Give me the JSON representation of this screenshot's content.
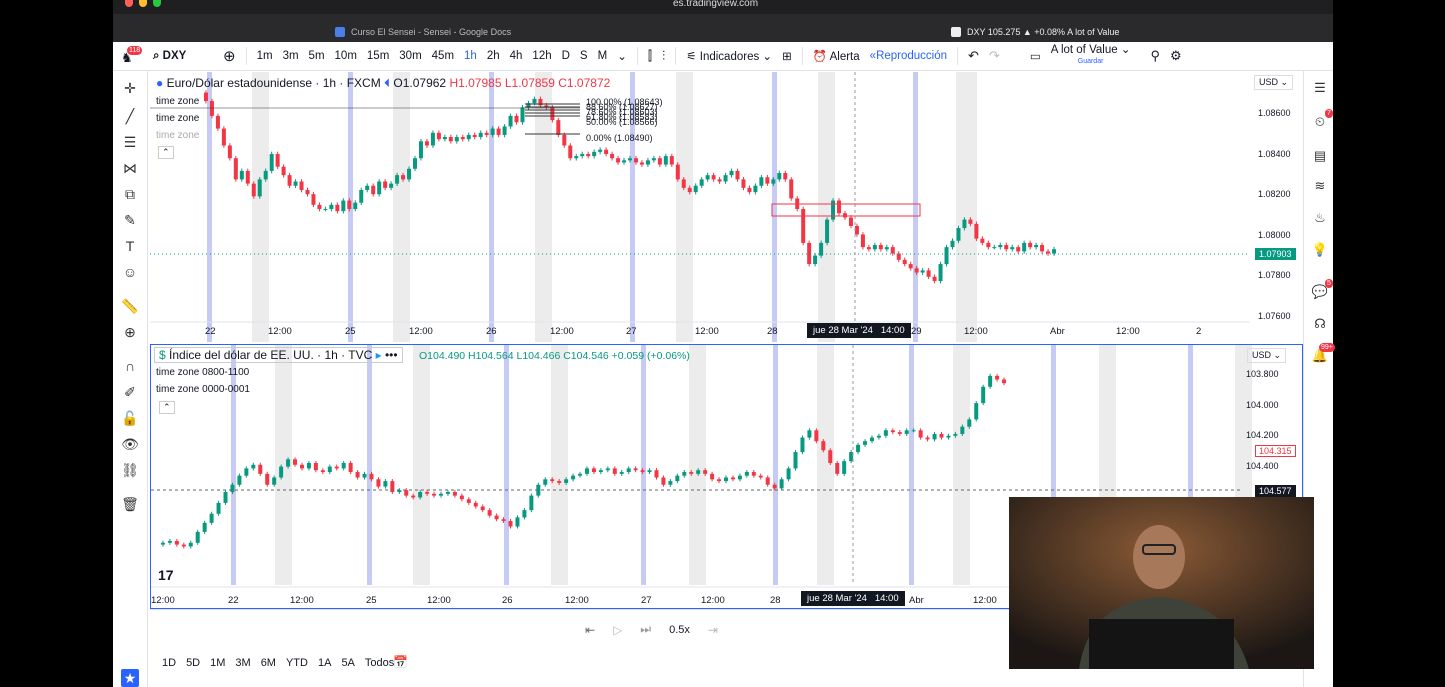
{
  "browser": {
    "url": "es.tradingview.com",
    "tab1": "Curso El Sensei - Sensei - Google Docs",
    "tab2": "DXY 105.275 ▲ +0.08% A lot of Value"
  },
  "toolbar": {
    "notif": "118",
    "symbol": "DXY",
    "intervals": [
      "1m",
      "3m",
      "5m",
      "10m",
      "15m",
      "30m",
      "45m",
      "1h",
      "2h",
      "4h",
      "12h",
      "D",
      "S",
      "M"
    ],
    "active_interval": "1h",
    "indicators": "Indicadores",
    "alert": "Alerta",
    "replay": "Reproducción",
    "layout_name": "A lot of Value",
    "layout_sub": "Guardar"
  },
  "pane1": {
    "title": "Euro/Dólar estadounidense · 1h · FXCM",
    "ohlc": {
      "o": "O1.07962",
      "h": "H1.07985",
      "l": "L1.07859",
      "c": "C1.07872"
    },
    "currency": "USD",
    "prices": [
      "1.08600",
      "1.08400",
      "1.08200",
      "1.08000",
      "1.07800",
      "1.07600"
    ],
    "last_price": "1.07903",
    "timezones": [
      "time zone",
      "time zone",
      "time zone"
    ],
    "fib": [
      "100.00% (1.08643)",
      "88.60% (1.08627)",
      "78.60% (1.08603)",
      "61.80% (1.08583)",
      "50.00% (1.08566)",
      "0.00% (1.08490)"
    ],
    "xlabels": [
      "22",
      "12:00",
      "25",
      "12:00",
      "26",
      "12:00",
      "27",
      "12:00",
      "28",
      "29",
      "12:00",
      "Abr",
      "12:00",
      "2"
    ],
    "crosshair_date": "jue 28 Mar '24",
    "crosshair_time": "14:00",
    "series": [
      1.0863,
      1.0859,
      1.0852,
      1.0846,
      1.0838,
      1.0832,
      1.0822,
      1.0826,
      1.082,
      1.0814,
      1.0822,
      1.0826,
      1.0834,
      1.0828,
      1.0824,
      1.0819,
      1.0821,
      1.0817,
      1.0815,
      1.081,
      1.0808,
      1.0808,
      1.081,
      1.0807,
      1.0812,
      1.0808,
      1.0811,
      1.0817,
      1.0819,
      1.0815,
      1.0821,
      1.0818,
      1.082,
      1.0824,
      1.0822,
      1.0827,
      1.0832,
      1.084,
      1.0838,
      1.0844,
      1.0841,
      1.0842,
      1.084,
      1.0842,
      1.0841,
      1.0843,
      1.0842,
      1.0844,
      1.0843,
      1.0846,
      1.0843,
      1.0847,
      1.0852,
      1.0849,
      1.0856,
      1.0858,
      1.086,
      1.0857,
      1.0856,
      1.085,
      1.0843,
      1.0838,
      1.0832,
      1.0833,
      1.0834,
      1.0833,
      1.0835,
      1.0836,
      1.0834,
      1.0832,
      1.083,
      1.0831,
      1.0832,
      1.083,
      1.0829,
      1.0831,
      1.0832,
      1.0829,
      1.0833,
      1.0829,
      1.0822,
      1.0818,
      1.0816,
      1.0819,
      1.0822,
      1.0824,
      1.0822,
      1.0821,
      1.0824,
      1.0826,
      1.0822,
      1.0818,
      1.0816,
      1.0819,
      1.0823,
      1.082,
      1.0822,
      1.0825,
      1.0822,
      1.0813,
      1.0808,
      1.0792,
      1.0782,
      1.0786,
      1.0792,
      1.0803,
      1.0812,
      1.0806,
      1.0804,
      1.08,
      1.0796,
      1.079,
      1.0789,
      1.0791,
      1.0789,
      1.079,
      1.0787,
      1.0784,
      1.0782,
      1.078,
      1.0778,
      1.0779,
      1.0776,
      1.0774,
      1.0782,
      1.079,
      1.0793,
      1.0799,
      1.0803,
      1.0801,
      1.0794,
      1.0792,
      1.079,
      1.079,
      1.0791,
      1.0789,
      1.079,
      1.0788,
      1.0792,
      1.079,
      1.0791,
      1.0788,
      1.0787,
      1.0789
    ]
  },
  "pane2": {
    "title": "Índice del dólar de EE. UU. · 1h · TVC",
    "ohlc": "O104.490 H104.564 L104.466 C104.546 +0.059 (+0.06%)",
    "currency": "USD",
    "prices": [
      "103.800",
      "104.000",
      "104.200",
      "104.400"
    ],
    "current_price": "104.315",
    "crosshair_price": "104.577",
    "timezones": [
      "time zone 0800-1100",
      "time zone 0000-0001"
    ],
    "xlabels": [
      "12:00",
      "22",
      "12:00",
      "25",
      "12:00",
      "26",
      "12:00",
      "27",
      "12:00",
      "28",
      "Abr",
      "12:00"
    ],
    "crosshair_date": "jue 28 Mar '24",
    "crosshair_time": "14:00",
    "series": [
      103.89,
      103.9,
      103.91,
      103.89,
      103.88,
      103.9,
      103.96,
      104.01,
      104.06,
      104.12,
      104.18,
      104.22,
      104.27,
      104.31,
      104.33,
      104.28,
      104.22,
      104.26,
      104.32,
      104.36,
      104.33,
      104.31,
      104.34,
      104.3,
      104.29,
      104.32,
      104.31,
      104.34,
      104.29,
      104.26,
      104.28,
      104.25,
      104.21,
      104.24,
      104.18,
      104.19,
      104.16,
      104.15,
      104.18,
      104.17,
      104.16,
      104.17,
      104.18,
      104.16,
      104.14,
      104.12,
      104.1,
      104.08,
      104.05,
      104.03,
      104.02,
      103.99,
      104.04,
      104.08,
      104.16,
      104.22,
      104.25,
      104.24,
      104.23,
      104.25,
      104.27,
      104.28,
      104.31,
      104.29,
      104.3,
      104.31,
      104.28,
      104.29,
      104.31,
      104.3,
      104.29,
      104.3,
      104.26,
      104.22,
      104.24,
      104.27,
      104.29,
      104.28,
      104.3,
      104.28,
      104.25,
      104.24,
      104.26,
      104.25,
      104.27,
      104.29,
      104.27,
      104.26,
      104.22,
      104.2,
      104.25,
      104.31,
      104.4,
      104.48,
      104.52,
      104.46,
      104.41,
      104.34,
      104.28,
      104.35,
      104.4,
      104.44,
      104.46,
      104.48,
      104.49,
      104.52,
      104.51,
      104.5,
      104.52,
      104.52,
      104.48,
      104.47,
      104.5,
      104.48,
      104.49,
      104.5,
      104.54,
      104.58,
      104.67,
      104.76,
      104.82,
      104.8,
      104.78
    ]
  },
  "bottom": {
    "speed": "0.5x",
    "timeframes": [
      "1D",
      "5D",
      "1M",
      "3M",
      "6M",
      "YTD",
      "1A",
      "5A",
      "Todos"
    ]
  },
  "colors": {
    "up": "#089981",
    "down": "#f23645",
    "accent": "#2962ff",
    "zone_blue": "#c5cbf5",
    "zone_gray": "#ececec"
  }
}
